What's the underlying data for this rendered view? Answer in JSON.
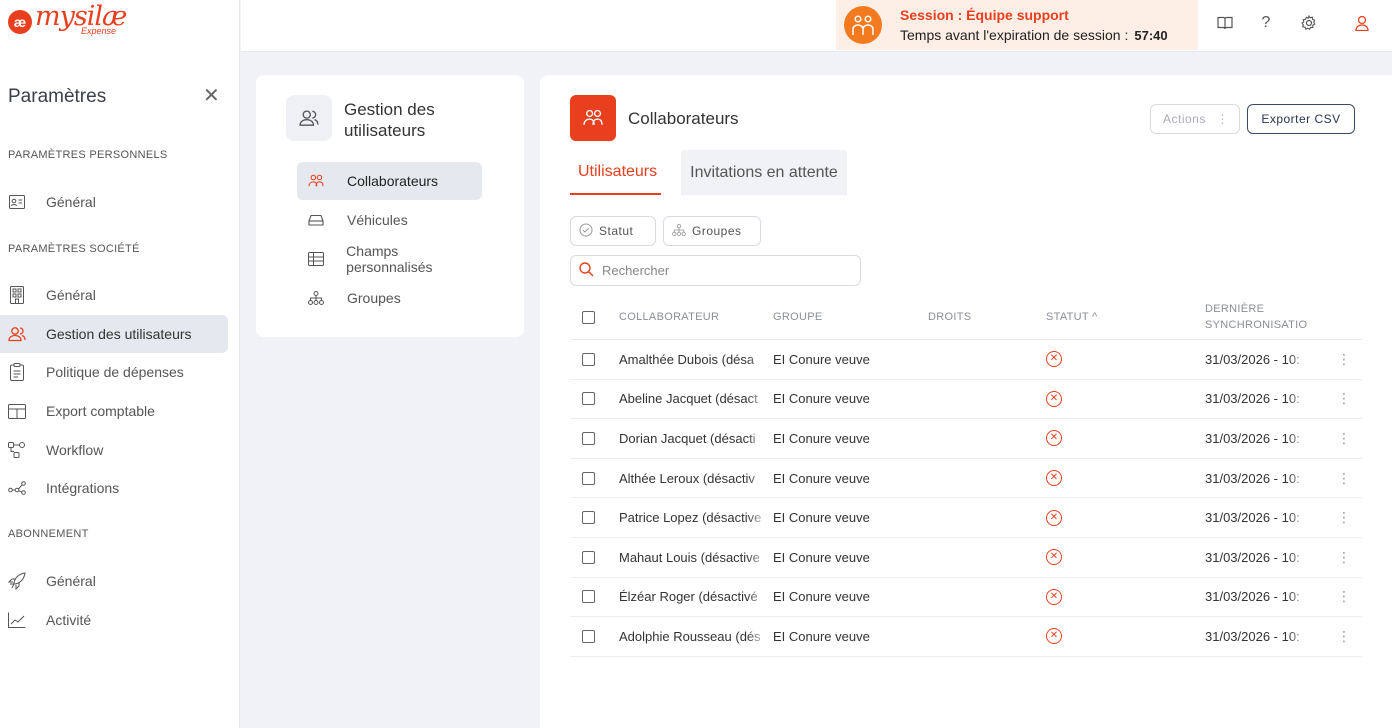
{
  "logo": {
    "mark": "æ",
    "name": "mysilæ",
    "sub": "Expense"
  },
  "sidebar": {
    "title": "Paramètres",
    "close_icon": "close-icon",
    "sections": [
      {
        "label": "PARAMÈTRES PERSONNELS"
      },
      {
        "label": "PARAMÈTRES SOCIÉTÉ"
      },
      {
        "label": "ABONNEMENT"
      }
    ],
    "items": [
      {
        "label": "Général",
        "icon": "id-card-icon"
      },
      {
        "label": "Général",
        "icon": "building-icon"
      },
      {
        "label": "Gestion des utilisateurs",
        "icon": "users-icon",
        "active": true
      },
      {
        "label": "Politique de dépenses",
        "icon": "clipboard-icon"
      },
      {
        "label": "Export comptable",
        "icon": "table-icon"
      },
      {
        "label": "Workflow",
        "icon": "workflow-icon"
      },
      {
        "label": "Intégrations",
        "icon": "integration-icon"
      },
      {
        "label": "Général",
        "icon": "rocket-icon"
      },
      {
        "label": "Activité",
        "icon": "chart-line-icon"
      }
    ]
  },
  "session": {
    "title": "Session : Équipe support",
    "label": "Temps avant l'expiration de session :",
    "time": "57:40"
  },
  "topbar_icons": [
    "book-icon",
    "help-icon",
    "gear-icon",
    "user-icon"
  ],
  "mid": {
    "title": "Gestion des utilisateurs",
    "items": [
      {
        "label": "Collaborateurs",
        "icon": "users-icon",
        "active": true
      },
      {
        "label": "Véhicules",
        "icon": "car-icon"
      },
      {
        "label": "Champs personnalisés",
        "icon": "table-icon"
      },
      {
        "label": "Groupes",
        "icon": "hierarchy-icon"
      }
    ]
  },
  "main": {
    "title": "Collaborateurs",
    "actions_label": "Actions",
    "export_label": "Exporter CSV",
    "tabs": [
      {
        "label": "Utilisateurs",
        "active": true
      },
      {
        "label": "Invitations en attente"
      }
    ],
    "filters": [
      {
        "label": "Statut",
        "icon": "check-circle-icon"
      },
      {
        "label": "Groupes",
        "icon": "hierarchy-icon"
      }
    ],
    "search_placeholder": "Rechercher"
  },
  "table": {
    "headers": {
      "collaborateur": "COLLABORATEUR",
      "groupe": "GROUPE",
      "droits": "DROITS",
      "statut": "STATUT ^",
      "sync_1": "DERNIÈRE",
      "sync_2": "SYNCHRONISATIO"
    },
    "rows": [
      {
        "name": "Amalthée Dubois (désa",
        "group": "EI Conure veuve",
        "date": "31/03/2026 - 10:"
      },
      {
        "name": "Abeline Jacquet (désact",
        "group": "EI Conure veuve",
        "date": "31/03/2026 - 10:"
      },
      {
        "name": "Dorian Jacquet (désacti",
        "group": "EI Conure veuve",
        "date": "31/03/2026 - 10:"
      },
      {
        "name": "Althée Leroux (désactiv",
        "group": "EI Conure veuve",
        "date": "31/03/2026 - 10:"
      },
      {
        "name": "Patrice Lopez (désactive",
        "group": "EI Conure veuve",
        "date": "31/03/2026 - 10:"
      },
      {
        "name": "Mahaut Louis (désactive",
        "group": "EI Conure veuve",
        "date": "31/03/2026 - 10:"
      },
      {
        "name": "Élzéar Roger (désactivé",
        "group": "EI Conure veuve",
        "date": "31/03/2026 - 10:"
      },
      {
        "name": "Adolphie Rousseau (dés",
        "group": "EI Conure veuve",
        "date": "31/03/2026 - 10:"
      }
    ]
  },
  "colors": {
    "accent": "#e8401f",
    "session_bg": "#fdefe6",
    "session_icon": "#f47a20"
  }
}
